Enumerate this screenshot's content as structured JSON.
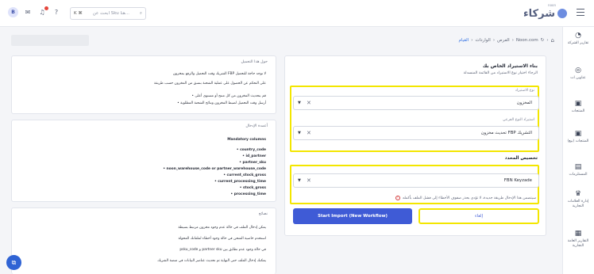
{
  "header": {
    "logo_text": "شركاء",
    "logo_sup": "noon",
    "search_placeholder": "ابحث عن Sku هنا...",
    "search_shortcut": "K ⌘",
    "avatar_initial": "B"
  },
  "sidebar": {
    "items": [
      {
        "label": "تقارير الشركة",
        "icon": "chart-icon"
      },
      {
        "label": "عناوين ات",
        "icon": "location-icon"
      },
      {
        "label": "المنتجات",
        "icon": "box-icon"
      },
      {
        "label": "المنتجات (بيع)",
        "icon": "box-sell-icon"
      },
      {
        "label": "المستلزمات",
        "icon": "document-icon"
      },
      {
        "label": "إدارة العلامات التجارية",
        "icon": "trophy-icon"
      },
      {
        "label": "التقارير العامة التجارية",
        "icon": "report-icon"
      }
    ]
  },
  "breadcrumb": {
    "items": [
      "Noon.com",
      "الفرص",
      "الواردات",
      "القيام"
    ]
  },
  "form": {
    "title": "بناء الاستيراد الخاص بك",
    "subtitle": "الرجاء اختيار نوع الاستيراد من القائمة المنسدلة",
    "import_type_label": "نوع الاستيراد",
    "import_type_value": "المخزون",
    "import_subtype_label": "استيراد النوع الفرعي",
    "import_subtype_value": "التشريك FBP تحديث مخزون",
    "section_title": "تخصيص المحدد",
    "keyzade_value": "FBN Keyzade",
    "warning": "سيتضمن هذا الإدخال طريقة جديدة، لا تؤدي بحذر صفوف الأخطاء إلى فشل الملف بأكمله",
    "primary_button": "Start Import (New Workflow)",
    "cancel_button": "إلغاء"
  },
  "info_about": {
    "title": "حول هذا التحميل",
    "lines": [
      "لا توجد حاجة للتحميل FBP الشريك وقت التحميل والرفع بمخزون",
      "على التحكم عن الحصول على عملية الشحنة بنسق من المخزون حسب طريقة",
      "قم بتحديث المخزون من كل منتج أو مستوى أعلى",
      "أرسل وقت التحميل لضبط المخزون ونتائج الشحنة المطلوبة"
    ]
  },
  "info_columns": {
    "title": "أعمدة الإدخال",
    "heading": "Mandatory columns",
    "columns": [
      "country_code",
      "id_partner",
      "partner_sku",
      "noon_warehouse_code or partner_warehouse_code",
      "current_stock_gross",
      "current_processing_time",
      "stock_gross",
      "processing_time"
    ]
  },
  "info_tips": {
    "title": "نصائح",
    "lines": [
      "يمكن إدخال الملف في حالة عدم وجود مخزون مرتبط بسيطة",
      "استخدم خاصية الشحن في حالة وجود أخطاء لملفاتك المحولة",
      "في حالة وجود عدم تطابق بين partner sku و psku_code",
      "يمكنك إدخال الملف حتى النهاية ثم تحديث عناصر البيانات في منصة الشريك"
    ]
  },
  "colors": {
    "primary": "#3f5bd6",
    "highlight": "#f3e600",
    "link": "#2f6fe3"
  }
}
